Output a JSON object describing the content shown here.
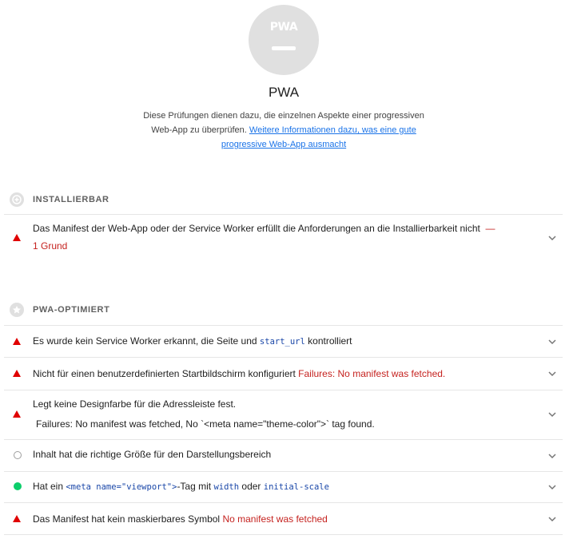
{
  "header": {
    "logo_text": "PWA",
    "title": "PWA",
    "description": "Diese Prüfungen dienen dazu, die einzelnen Aspekte einer progressiven Web-App zu überprüfen. ",
    "link_text": "Weitere Informationen dazu, was eine gute progressive Web-App ausmacht"
  },
  "groups": {
    "installable": {
      "title": "INSTALLIERBAR",
      "icon": "plus-circle-icon"
    },
    "optimized": {
      "title": "PWA-OPTIMIERT",
      "icon": "star-icon"
    }
  },
  "audits": {
    "a1": {
      "status": "fail",
      "text": "Das Manifest der Web-App oder der Service Worker erfüllt die Anforderungen an die Installierbarkeit nicht",
      "detail_dash": "—",
      "detail": "1 Grund"
    },
    "a2": {
      "status": "fail",
      "text_before": "Es wurde kein Service Worker erkannt, die Seite und ",
      "code": "start_url",
      "text_after": " kontrolliert"
    },
    "a3": {
      "status": "fail",
      "text": "Nicht für einen benutzerdefinierten Startbildschirm konfiguriert",
      "detail": "Failures: No manifest was fetched."
    },
    "a4": {
      "status": "fail",
      "text": "Legt keine Designfarbe für die Adressleiste fest.",
      "detail": "Failures: No manifest was fetched, No `<meta name=\"theme-color\">` tag found."
    },
    "a5": {
      "status": "manual",
      "text": "Inhalt hat die richtige Größe für den Darstellungsbereich"
    },
    "a6": {
      "status": "pass",
      "text_before": "Hat ein ",
      "code1": "<meta name=\"viewport\">",
      "text_mid1": "-Tag mit ",
      "code2": "width",
      "text_mid2": " oder ",
      "code3": "initial-scale"
    },
    "a7": {
      "status": "fail",
      "text": "Das Manifest hat kein maskierbares Symbol",
      "detail": "No manifest was fetched"
    }
  },
  "colors": {
    "fail": "#e00000",
    "fail_text": "#c5221f",
    "pass": "#0cce6b",
    "link": "#1a73e8",
    "code": "#1a47a8"
  }
}
